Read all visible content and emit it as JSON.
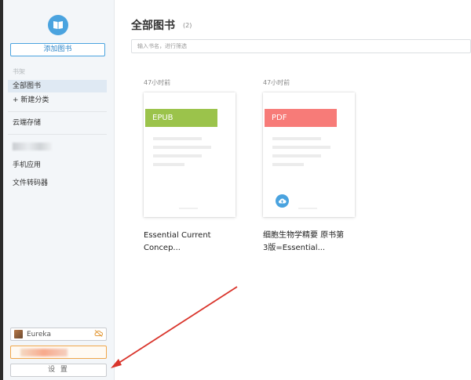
{
  "sidebar": {
    "add_book_label": "添加图书",
    "section_label": "书架",
    "items": [
      {
        "label": "全部图书"
      },
      {
        "label": "+   新建分类"
      },
      {
        "label": "云端存储"
      },
      {
        "label": "手机应用"
      },
      {
        "label": "文件转码器"
      }
    ],
    "user": {
      "name": "Eureka"
    },
    "settings_label": "设 置"
  },
  "main": {
    "title": "全部图书",
    "count": "(2)",
    "search_placeholder": "输入书名，进行筛选",
    "books": [
      {
        "time": "47小时前",
        "format": "EPUB",
        "title_line1": "Essential Current",
        "title_line2": "Concep..."
      },
      {
        "time": "47小时前",
        "format": "PDF",
        "title_line1": "细胞生物学精要 原书第",
        "title_line2": "3版=Essential..."
      }
    ]
  },
  "colors": {
    "accent": "#4aa3df",
    "epub_band": "#9bc34b",
    "pdf_band": "#f77b78",
    "arrow": "#d9342b",
    "vip_border": "#f0a64a"
  },
  "icons": {
    "logo": "book-icon",
    "cloud_off": "cloud-off-icon",
    "cloud_upload": "cloud-upload-icon"
  }
}
